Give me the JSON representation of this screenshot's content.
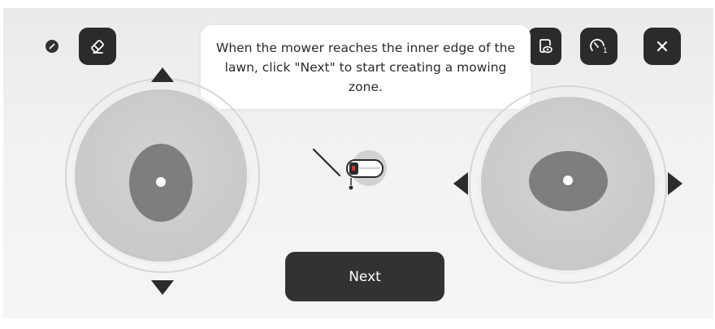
{
  "toolbar": {
    "left": [
      {
        "name": "indicator-icon"
      },
      {
        "name": "eraser-icon"
      }
    ],
    "right": [
      {
        "name": "visibility-icon"
      },
      {
        "name": "speed-gauge-icon",
        "badge": "1"
      },
      {
        "name": "close-icon"
      }
    ]
  },
  "tooltip": {
    "text": "When the mower reaches the inner edge of the lawn, click \"Next\" to start creating a mowing zone."
  },
  "joysticks": {
    "left": {
      "axis": "vertical",
      "arrows": [
        "up",
        "down"
      ]
    },
    "right": {
      "axis": "horizontal",
      "arrows": [
        "left",
        "right"
      ]
    }
  },
  "mower": {
    "icon": "mower-icon"
  },
  "actions": {
    "next_label": "Next"
  },
  "colors": {
    "button_dark": "#2b2b2b",
    "joystick_base": "#c8cacc",
    "knob": "#7c7e80",
    "background": "#eceeef"
  }
}
